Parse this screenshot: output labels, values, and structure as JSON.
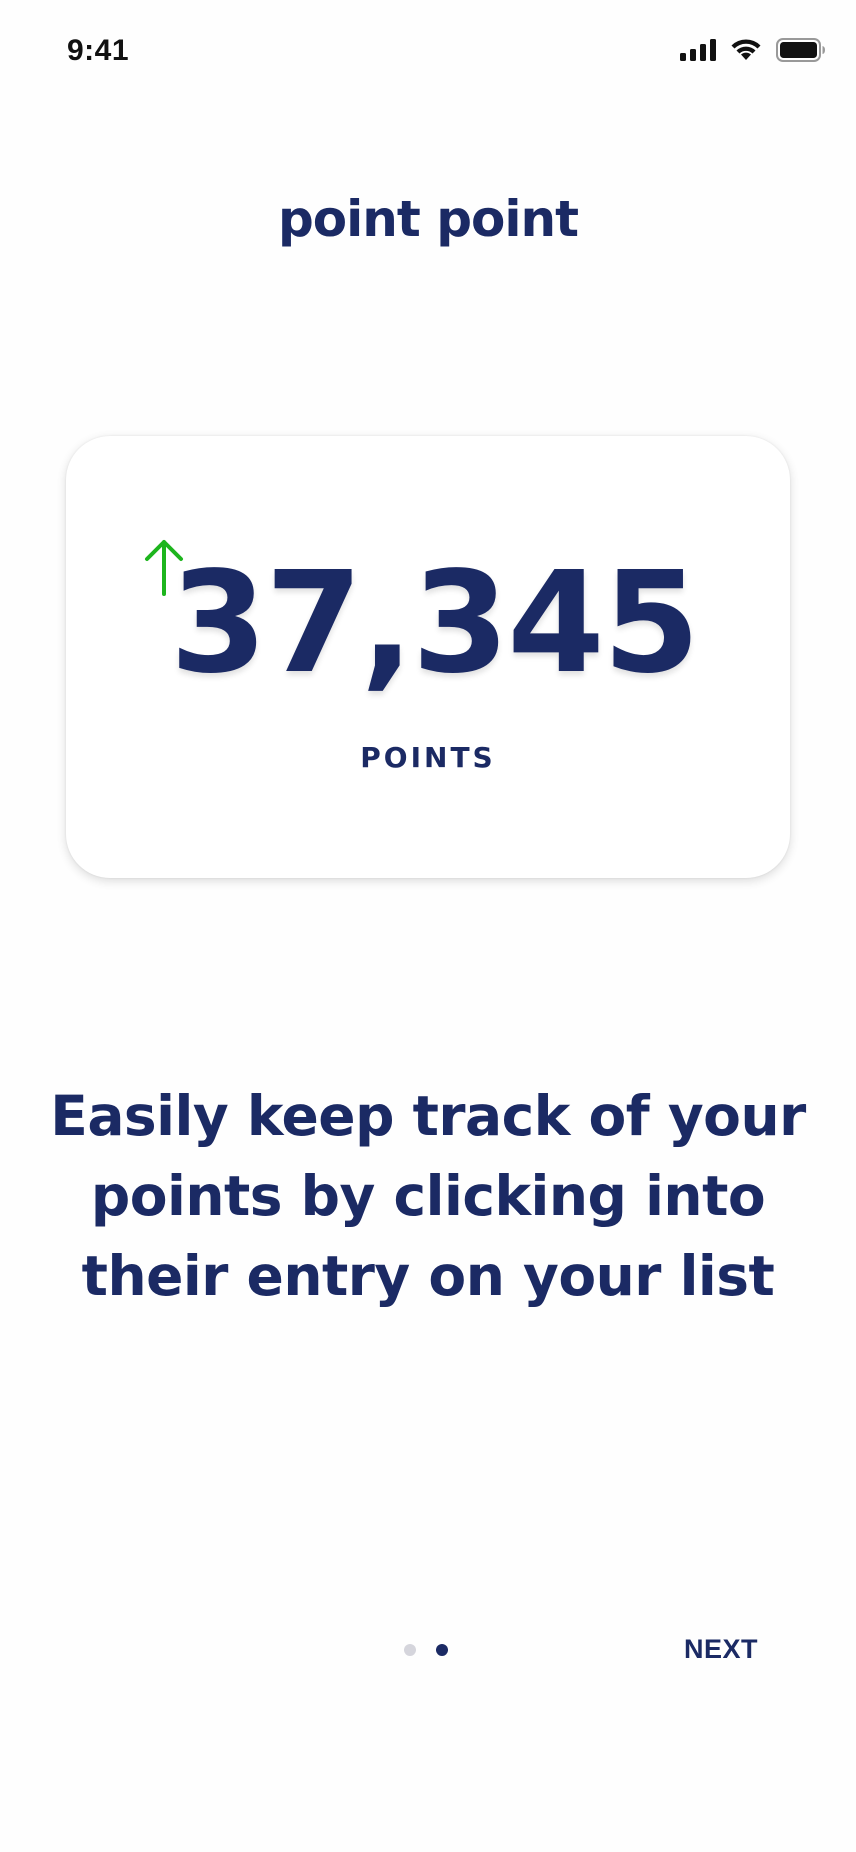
{
  "status_bar": {
    "time": "9:41",
    "icons": [
      "cellular-signal-icon",
      "wifi-icon",
      "battery-icon"
    ]
  },
  "app": {
    "logo_text": "point point"
  },
  "points_card": {
    "value": "37,345",
    "label": "POINTS",
    "trend_icon": "arrow-up-icon",
    "trend_color": "#1db51d"
  },
  "onboarding": {
    "tagline": "Easily keep track of your points by clicking into their entry on your list",
    "page_count": 2,
    "current_page": 2,
    "next_label": "NEXT"
  },
  "colors": {
    "brand": "#1b2a64",
    "dot_inactive": "#d5d5dc",
    "background": "#fefefe"
  }
}
